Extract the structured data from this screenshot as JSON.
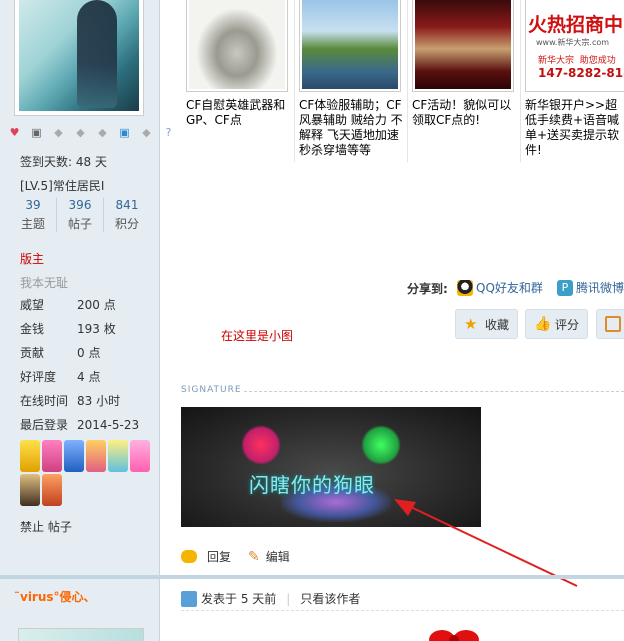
{
  "profile": {
    "signin_days": "签到天数: 48 天",
    "level": "[LV.5]常住居民I",
    "stats": [
      {
        "num": "39",
        "label": "主题"
      },
      {
        "num": "396",
        "label": "帖子"
      },
      {
        "num": "841",
        "label": "积分"
      }
    ],
    "group": "版主",
    "motto": "我本无耻",
    "fields": [
      {
        "k": "威望",
        "v": "200 点"
      },
      {
        "k": "金钱",
        "v": "193 枚"
      },
      {
        "k": "贡献",
        "v": "0 点"
      },
      {
        "k": "好评度",
        "v": "4 点"
      },
      {
        "k": "在线时间",
        "v": "83 小时"
      },
      {
        "k": "最后登录",
        "v": "2014-5-23"
      }
    ],
    "ban_text": "禁止 帖子",
    "next_user": "˜virus°侵心、"
  },
  "ads": [
    {
      "text": "CF自慰英雄武器和GP、CF点"
    },
    {
      "text": "CF体验服辅助；CF风暴辅助 贼给力 不解释 飞天遁地加速秒杀穿墙等等"
    },
    {
      "text": "CF活动！貌似可以领取CF点的!"
    },
    {
      "text": "新华银开户>>超低手续费+语音喊单+送买卖提示软件!",
      "banner_title": "火热招商中",
      "banner_url": "www.新华大宗.com",
      "banner_slogan1": "新华大宗",
      "banner_slogan2": "助您成功",
      "banner_phone": "147-8282-8182"
    }
  ],
  "share": {
    "label": "分享到:",
    "items": [
      {
        "label": "QQ好友和群",
        "icon": "penguin-icon",
        "color": "#2a8ad4"
      },
      {
        "label": "腾讯微博",
        "icon": "tencent-weibo-icon",
        "color": "#3aa0c8"
      }
    ]
  },
  "actions": {
    "favorite": "收藏",
    "rate": "评分"
  },
  "note": "在这里是小图",
  "signature": {
    "label": "SIGNATURE",
    "image_text": "闪瞎你的狗眼"
  },
  "reply": {
    "reply_label": "回复",
    "edit_label": "编辑"
  },
  "next_post": {
    "posted": "发表于 5 天前",
    "only_author": "只看该作者"
  }
}
